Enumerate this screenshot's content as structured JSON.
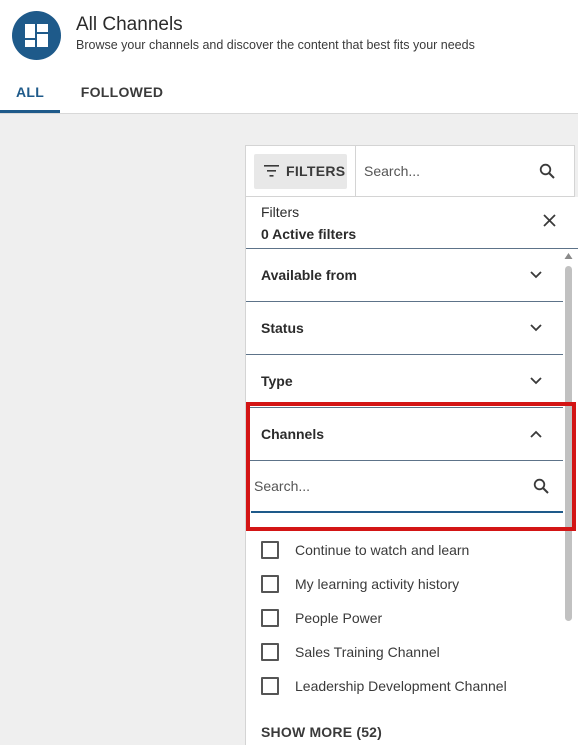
{
  "header": {
    "icon": "channels-grid-icon",
    "title": "All Channels",
    "subtitle": "Browse your channels and discover the content that best fits your needs"
  },
  "tabs": [
    {
      "label": "ALL",
      "active": true
    },
    {
      "label": "FOLLOWED",
      "active": false
    }
  ],
  "toolbar": {
    "filters_label": "FILTERS",
    "search_placeholder": "Search..."
  },
  "panel": {
    "title": "Filters",
    "active_count": "0 Active filters",
    "sections": [
      {
        "label": "Available from",
        "expanded": false
      },
      {
        "label": "Status",
        "expanded": false
      },
      {
        "label": "Type",
        "expanded": false
      },
      {
        "label": "Channels",
        "expanded": true
      }
    ],
    "channel_search_placeholder": "Search...",
    "channels": [
      {
        "label": "Continue to watch and learn",
        "checked": false
      },
      {
        "label": "My learning activity history",
        "checked": false
      },
      {
        "label": "People Power",
        "checked": false
      },
      {
        "label": "Sales Training Channel",
        "checked": false
      },
      {
        "label": "Leadership Development Channel",
        "checked": false
      }
    ],
    "show_more": "SHOW MORE (52)"
  },
  "colors": {
    "accent": "#1e5a8a",
    "highlight": "#d31515",
    "background": "#efefef"
  }
}
